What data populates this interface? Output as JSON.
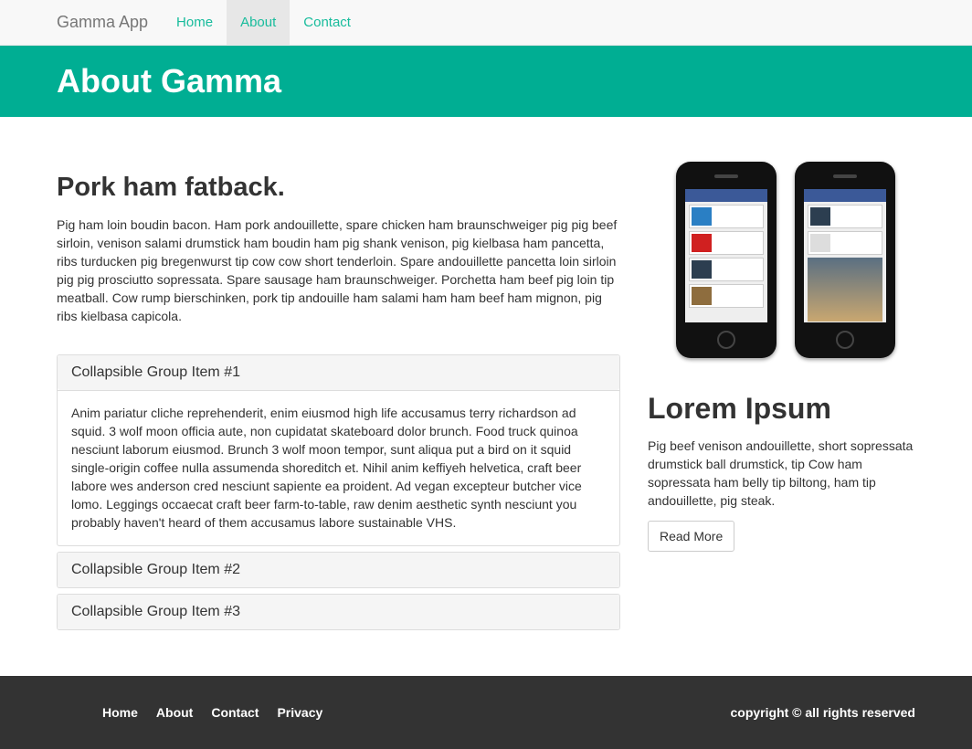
{
  "nav": {
    "brand": "Gamma App",
    "links": [
      "Home",
      "About",
      "Contact"
    ],
    "active": "About"
  },
  "hero": {
    "title": "About Gamma"
  },
  "main": {
    "heading": "Pork ham fatback.",
    "paragraph": "Pig ham loin boudin bacon. Ham pork andouillette, spare chicken ham braunschweiger pig pig beef sirloin, venison salami drumstick ham boudin ham pig shank venison, pig kielbasa ham pancetta, ribs turducken pig bregenwurst tip cow cow short tenderloin. Spare andouillette pancetta loin sirloin pig pig prosciutto sopressata. Spare sausage ham braunschweiger. Porchetta ham beef pig loin tip meatball. Cow rump bierschinken, pork tip andouille ham salami ham ham beef ham mignon, pig ribs kielbasa capicola."
  },
  "accordion": {
    "items": [
      {
        "title": "Collapsible Group Item #1",
        "body": "Anim pariatur cliche reprehenderit, enim eiusmod high life accusamus terry richardson ad squid. 3 wolf moon officia aute, non cupidatat skateboard dolor brunch. Food truck quinoa nesciunt laborum eiusmod. Brunch 3 wolf moon tempor, sunt aliqua put a bird on it squid single-origin coffee nulla assumenda shoreditch et. Nihil anim keffiyeh helvetica, craft beer labore wes anderson cred nesciunt sapiente ea proident. Ad vegan excepteur butcher vice lomo. Leggings occaecat craft beer farm-to-table, raw denim aesthetic synth nesciunt you probably haven't heard of them accusamus labore sustainable VHS."
      },
      {
        "title": "Collapsible Group Item #2"
      },
      {
        "title": "Collapsible Group Item #3"
      }
    ]
  },
  "sidebar": {
    "heading": "Lorem Ipsum",
    "paragraph": "Pig beef venison andouillette, short sopressata drumstick ball drumstick, tip Cow ham sopressata ham belly tip biltong, ham tip andouillette, pig steak.",
    "button": "Read More"
  },
  "footer": {
    "links": [
      "Home",
      "About",
      "Contact",
      "Privacy"
    ],
    "copyright": "copyright © all rights reserved"
  },
  "colors": {
    "accent": "#18bc9c",
    "hero": "#00ae93",
    "footer": "#333333"
  },
  "icons": [
    "phone-image"
  ]
}
